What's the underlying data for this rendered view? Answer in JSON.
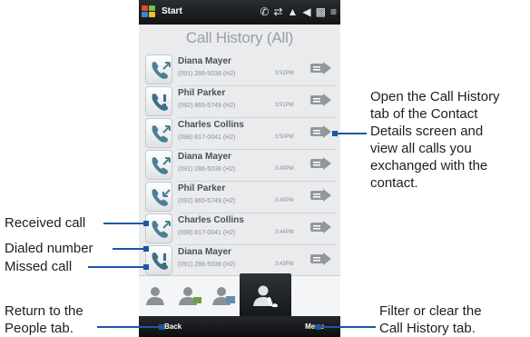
{
  "status_bar": {
    "start_label": "Start",
    "icons": [
      "phone-call-icon",
      "sync-icon",
      "signal-icon",
      "volume-icon",
      "battery-icon",
      "antenna-icon"
    ]
  },
  "screen": {
    "title": "Call History (All)"
  },
  "calls": [
    {
      "type": "dialed",
      "name": "Diana Mayer",
      "number": "(091) 286-5038 (H2)",
      "time": "3:52PM"
    },
    {
      "type": "missed",
      "name": "Phil Parker",
      "number": "(092) 865-5749 (H2)",
      "time": "3:51PM"
    },
    {
      "type": "dialed",
      "name": "Charles Collins",
      "number": "(098) 817-0041 (H2)",
      "time": "3:50PM"
    },
    {
      "type": "dialed",
      "name": "Diana Mayer",
      "number": "(091) 286-5038 (H2)",
      "time": "3:49PM"
    },
    {
      "type": "received",
      "name": "Phil Parker",
      "number": "(092) 865-5749 (H2)",
      "time": "3:49PM"
    },
    {
      "type": "dialed",
      "name": "Charles Collins",
      "number": "(098) 817-0041 (H2)",
      "time": "3:44PM"
    },
    {
      "type": "missed",
      "name": "Diana Mayer",
      "number": "(091) 286-5038 (H2)",
      "time": "3:43PM"
    }
  ],
  "tabs": [
    {
      "name": "tab-people",
      "icon": "person-icon"
    },
    {
      "name": "tab-contact-card",
      "icon": "person-card-icon"
    },
    {
      "name": "tab-messages",
      "icon": "person-message-icon"
    },
    {
      "name": "tab-call-history",
      "icon": "person-phone-icon",
      "active": true
    }
  ],
  "soft_keys": {
    "left": "Back",
    "right": "Menu"
  },
  "callouts": {
    "details": [
      "Open the Call History",
      "tab of the Contact",
      "Details screen and",
      "view all calls you",
      "exchanged with the",
      "contact."
    ],
    "received": "Received call",
    "dialed": "Dialed number",
    "missed": "Missed call",
    "back": [
      "Return to the",
      "People tab."
    ],
    "menu": [
      "Filter or clear the",
      "Call History tab."
    ]
  },
  "colors": {
    "leader_line": "#1d55a8",
    "phone_bg": "#e9ebed",
    "dialed_icon": "#4b7f99",
    "missed_icon": "#3a6f8a",
    "details_icon": "#93979c",
    "dark_bar": "#1a1c1f"
  }
}
